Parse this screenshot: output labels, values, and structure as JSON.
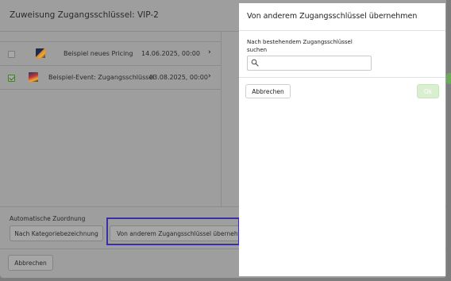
{
  "background_dialog": {
    "title": "Zuweisung Zugangsschlüssel: VIP-2",
    "rows": [
      {
        "checked": false,
        "name": "Beispiel neues Pricing",
        "date": "14.06.2025, 00:00"
      },
      {
        "checked": true,
        "name": "Beispiel-Event: Zugangsschlüssel",
        "date": "03.08.2025, 00:00"
      }
    ],
    "auto_assign_label": "Automatische Zuordnung",
    "by_category_button": "Nach Kategoriebezeichnung",
    "from_other_key_button": "Von anderem Zugangsschlüssel übernehmen",
    "cancel_button": "Abbrechen"
  },
  "panel": {
    "title": "Von anderem Zugangsschlüssel übernehmen",
    "search_label": "Nach bestehendem Zugangsschlüssel suchen",
    "search_value": "",
    "search_placeholder": "",
    "cancel_button": "Abbrechen",
    "ok_button": "Ok"
  },
  "colors": {
    "ok_button_bg": "#d9efcf",
    "highlight_border": "#3b2fa8",
    "checkbox_checked": "#3f6b2f"
  },
  "icons": {
    "search": "search-icon",
    "row_chevron": "chevron-right-icon"
  }
}
